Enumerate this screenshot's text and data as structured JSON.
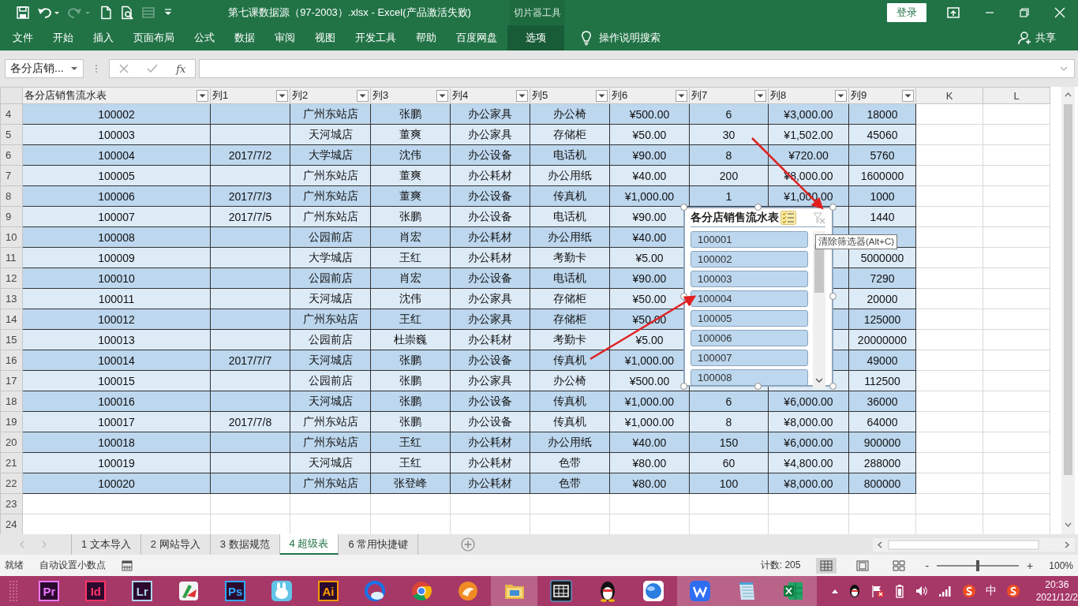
{
  "title_bar": {
    "quick_access": [
      {
        "kind": "save",
        "disabled": false
      },
      {
        "kind": "undo",
        "disabled": false
      },
      {
        "kind": "redo",
        "disabled": true
      },
      {
        "kind": "new",
        "disabled": false
      },
      {
        "kind": "preview",
        "disabled": false
      },
      {
        "kind": "form",
        "disabled": true
      },
      {
        "kind": "customize",
        "disabled": false
      }
    ],
    "title": "第七课数据源（97-2003）.xlsx  -  Excel(产品激活失败)",
    "context_label": "切片器工具",
    "login": "登录"
  },
  "ribbon": {
    "tabs": [
      {
        "label": "文件",
        "selected": false
      },
      {
        "label": "开始",
        "selected": false
      },
      {
        "label": "插入",
        "selected": false
      },
      {
        "label": "页面布局",
        "selected": false
      },
      {
        "label": "公式",
        "selected": false
      },
      {
        "label": "数据",
        "selected": false
      },
      {
        "label": "审阅",
        "selected": false
      },
      {
        "label": "视图",
        "selected": false
      },
      {
        "label": "开发工具",
        "selected": false
      },
      {
        "label": "帮助",
        "selected": false
      },
      {
        "label": "百度网盘",
        "selected": false
      },
      {
        "label": "选项",
        "selected": true
      }
    ],
    "search": "操作说明搜索",
    "share": "共享"
  },
  "formula_bar": {
    "name_box": "各分店销...",
    "function_label": "fx"
  },
  "sheet": {
    "columns": [
      {
        "label": "各分店销售流水表",
        "filter": true
      },
      {
        "label": "列1",
        "filter": true
      },
      {
        "label": "列2",
        "filter": true
      },
      {
        "label": "列3",
        "filter": true
      },
      {
        "label": "列4",
        "filter": true
      },
      {
        "label": "列5",
        "filter": true
      },
      {
        "label": "列6",
        "filter": true
      },
      {
        "label": "列7",
        "filter": true
      },
      {
        "label": "列8",
        "filter": true
      },
      {
        "label": "列9",
        "filter": true
      },
      {
        "label": "K",
        "filter": false
      },
      {
        "label": "L",
        "filter": false
      }
    ],
    "rows": [
      {
        "number": "4",
        "cells": [
          "100002",
          null,
          "广州东站店",
          "张鹏",
          "办公家具",
          "办公椅",
          "¥500.00",
          "6",
          "¥3,000.00",
          "18000"
        ]
      },
      {
        "number": "5",
        "cells": [
          "100003",
          null,
          "天河城店",
          "董爽",
          "办公家具",
          "存储柜",
          "¥50.00",
          "30",
          "¥1,502.00",
          "45060"
        ]
      },
      {
        "number": "6",
        "cells": [
          "100004",
          "2017/7/2",
          "大学城店",
          "沈伟",
          "办公设备",
          "电话机",
          "¥90.00",
          "8",
          "¥720.00",
          "5760"
        ]
      },
      {
        "number": "7",
        "cells": [
          "100005",
          null,
          "广州东站店",
          "董爽",
          "办公耗材",
          "办公用纸",
          "¥40.00",
          "200",
          "¥8,000.00",
          "1600000"
        ]
      },
      {
        "number": "8",
        "cells": [
          "100006",
          "2017/7/3",
          "广州东站店",
          "董爽",
          "办公设备",
          "传真机",
          "¥1,000.00",
          "1",
          "¥1,000.00",
          "1000"
        ]
      },
      {
        "number": "9",
        "cells": [
          "100007",
          "2017/7/5",
          "广州东站店",
          "张鹏",
          "办公设备",
          "电话机",
          "¥90.00",
          null,
          null,
          "1440"
        ]
      },
      {
        "number": "10",
        "cells": [
          "100008",
          null,
          "公园前店",
          "肖宏",
          "办公耗材",
          "办公用纸",
          "¥40.00",
          null,
          null,
          null
        ]
      },
      {
        "number": "11",
        "cells": [
          "100009",
          null,
          "大学城店",
          "王红",
          "办公耗材",
          "考勤卡",
          "¥5.00",
          null,
          null,
          "5000000"
        ]
      },
      {
        "number": "12",
        "cells": [
          "100010",
          null,
          "公园前店",
          "肖宏",
          "办公设备",
          "电话机",
          "¥90.00",
          null,
          null,
          "7290"
        ]
      },
      {
        "number": "13",
        "cells": [
          "100011",
          null,
          "天河城店",
          "沈伟",
          "办公家具",
          "存储柜",
          "¥50.00",
          null,
          null,
          "20000"
        ]
      },
      {
        "number": "14",
        "cells": [
          "100012",
          null,
          "广州东站店",
          "王红",
          "办公家具",
          "存储柜",
          "¥50.00",
          null,
          null,
          "125000"
        ]
      },
      {
        "number": "15",
        "cells": [
          "100013",
          null,
          "公园前店",
          "杜崇巍",
          "办公耗材",
          "考勤卡",
          "¥5.00",
          null,
          null,
          "20000000"
        ]
      },
      {
        "number": "16",
        "cells": [
          "100014",
          "2017/7/7",
          "天河城店",
          "张鹏",
          "办公设备",
          "传真机",
          "¥1,000.00",
          null,
          null,
          "49000"
        ]
      },
      {
        "number": "17",
        "cells": [
          "100015",
          null,
          "公园前店",
          "张鹏",
          "办公家具",
          "办公椅",
          "¥500.00",
          null,
          null,
          "112500"
        ]
      },
      {
        "number": "18",
        "cells": [
          "100016",
          null,
          "天河城店",
          "张鹏",
          "办公设备",
          "传真机",
          "¥1,000.00",
          "6",
          "¥6,000.00",
          "36000"
        ]
      },
      {
        "number": "19",
        "cells": [
          "100017",
          "2017/7/8",
          "广州东站店",
          "张鹏",
          "办公设备",
          "传真机",
          "¥1,000.00",
          "8",
          "¥8,000.00",
          "64000"
        ]
      },
      {
        "number": "20",
        "cells": [
          "100018",
          null,
          "广州东站店",
          "王红",
          "办公耗材",
          "办公用纸",
          "¥40.00",
          "150",
          "¥6,000.00",
          "900000"
        ]
      },
      {
        "number": "21",
        "cells": [
          "100019",
          null,
          "天河城店",
          "王红",
          "办公耗材",
          "色带",
          "¥80.00",
          "60",
          "¥4,800.00",
          "288000"
        ]
      },
      {
        "number": "22",
        "cells": [
          "100020",
          null,
          "广州东站店",
          "张登峰",
          "办公耗材",
          "色带",
          "¥80.00",
          "100",
          "¥8,000.00",
          "800000"
        ]
      }
    ],
    "empty_rows": [
      "23",
      "24"
    ]
  },
  "slicer": {
    "title": "各分店销售流水表",
    "multi_select": true,
    "clear_disabled": true,
    "items": [
      {
        "label": "100001",
        "selected": true
      },
      {
        "label": "100002",
        "selected": true
      },
      {
        "label": "100003",
        "selected": true
      },
      {
        "label": "100004",
        "selected": true
      },
      {
        "label": "100005",
        "selected": true
      },
      {
        "label": "100006",
        "selected": true
      },
      {
        "label": "100007",
        "selected": true
      },
      {
        "label": "100008",
        "selected": true
      }
    ],
    "tooltip": "清除筛选器(Alt+C)"
  },
  "annotations": [
    {
      "kind": "arrow"
    },
    {
      "kind": "arrow"
    }
  ],
  "sheet_tabs": {
    "tabs": [
      {
        "label": "1 文本导入",
        "selected": false
      },
      {
        "label": "2 网站导入",
        "selected": false
      },
      {
        "label": "3 数据规范",
        "selected": false
      },
      {
        "label": "4 超级表",
        "selected": true
      },
      {
        "label": "6 常用快捷键",
        "selected": false
      }
    ]
  },
  "status_bar": {
    "mode": "就绪",
    "decimal": "自动设置小数点",
    "count": "计数: 205",
    "views": [
      {
        "kind": "normal",
        "selected": true
      },
      {
        "kind": "layout",
        "selected": false
      },
      {
        "kind": "break",
        "selected": false
      }
    ],
    "zoom_out": "-",
    "zoom_in": "+",
    "zoom": {
      "level": 0.5
    },
    "zoom_text": "100%"
  },
  "taskbar": {
    "apps": [
      {
        "kind": "letter",
        "label": "Pr",
        "color": "#ea77ff",
        "running": false
      },
      {
        "kind": "letter",
        "label": "Id",
        "color": "#ff3366",
        "running": false
      },
      {
        "kind": "letter",
        "label": "Lr",
        "color": "#add5ec",
        "running": false
      },
      {
        "kind": "snip",
        "running": false
      },
      {
        "kind": "letter",
        "label": "Ps",
        "color": "#31a8ff",
        "running": false
      },
      {
        "kind": "rabbit",
        "running": false
      },
      {
        "kind": "letter",
        "label": "Ai",
        "color": "#ff9a00",
        "running": false
      },
      {
        "kind": "cloud",
        "running": false
      },
      {
        "kind": "chrome",
        "running": false
      },
      {
        "kind": "fox",
        "running": false
      },
      {
        "kind": "folder",
        "running": true
      },
      {
        "kind": "film",
        "running": false
      },
      {
        "kind": "penguin",
        "running": false
      },
      {
        "kind": "globe",
        "running": false
      },
      {
        "kind": "wps",
        "running": true
      },
      {
        "kind": "notepad",
        "running": true
      },
      {
        "kind": "sheet",
        "running": true
      }
    ],
    "tray": {
      "ime": "中",
      "time": "20:36",
      "date": "2021/12/2"
    }
  }
}
